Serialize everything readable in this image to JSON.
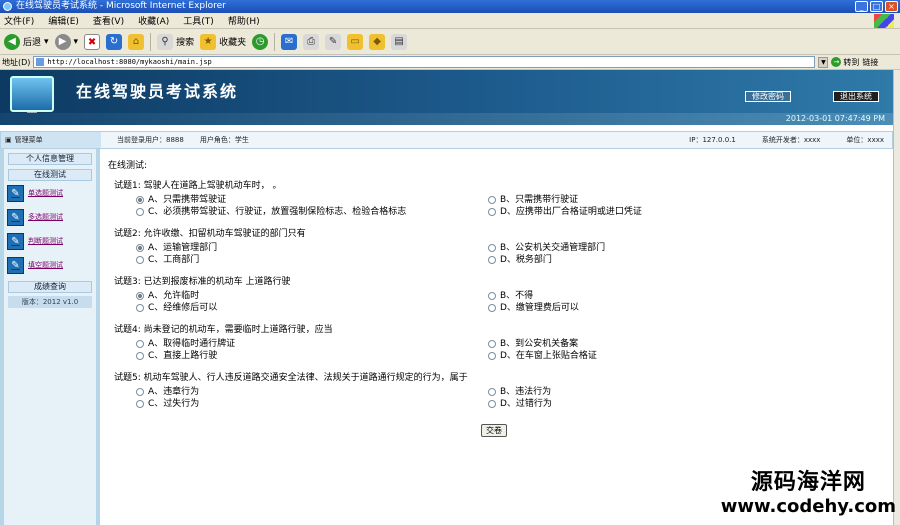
{
  "window": {
    "title": "在线驾驶员考试系统 - Microsoft Internet Explorer"
  },
  "menu": [
    "文件(F)",
    "编辑(E)",
    "查看(V)",
    "收藏(A)",
    "工具(T)",
    "帮助(H)"
  ],
  "toolbar": {
    "back": "后退",
    "search": "搜索",
    "favorites": "收藏夹"
  },
  "address": {
    "label": "地址(D)",
    "url": "http://localhost:8080/mykaoshi/main.jsp",
    "go": "转到",
    "links": "链接"
  },
  "banner": {
    "title": "在线驾驶员考试系统",
    "change_password": "修改密码",
    "logout": "退出系统",
    "datetime": "2012-03-01 07:47:49 PM"
  },
  "infobar": {
    "menu_title": "管理菜单",
    "current_user": "当前登录用户：8888",
    "role": "用户角色：学生",
    "ip": "IP：127.0.0.1",
    "developer": "系统开发者：xxxx",
    "unit": "单位：xxxx"
  },
  "sidebar": {
    "personal": "个人信息管理",
    "online_test": "在线测试",
    "items": [
      "单选题测试",
      "多选题测试",
      "判断题测试",
      "填空题测试"
    ],
    "grades": "成绩查询",
    "version": "版本：2012 v1.0"
  },
  "main": {
    "heading": "在线测试:",
    "submit": "交卷"
  },
  "questions": [
    {
      "title": "试题1: 驾驶人在道路上驾驶机动车时，   。",
      "options": [
        "A、只需携带驾驶证",
        "B、只需携带行驶证",
        "C、必须携带驾驶证、行驶证，放置强制保险标志、检验合格标志",
        "D、应携带出厂合格证明或进口凭证"
      ],
      "selected": 0
    },
    {
      "title": "试题2: 允许收缴、扣留机动车驾驶证的部门只有",
      "options": [
        "A、运输管理部门",
        "B、公安机关交通管理部门",
        "C、工商部门",
        "D、税务部门"
      ],
      "selected": 0
    },
    {
      "title": "试题3: 已达到报废标准的机动车    上道路行驶",
      "options": [
        "A、允许临时",
        "B、不得",
        "C、经维修后可以",
        "D、缴管理费后可以"
      ],
      "selected": 0
    },
    {
      "title": "试题4: 尚未登记的机动车，需要临时上道路行驶，应当",
      "options": [
        "A、取得临时通行牌证",
        "B、到公安机关备案",
        "C、直接上路行驶",
        "D、在车窗上张贴合格证"
      ],
      "selected": -1
    },
    {
      "title": "试题5: 机动车驾驶人、行人违反道路交通安全法律、法规关于道路通行规定的行为，属于",
      "options": [
        "A、违章行为",
        "B、违法行为",
        "C、过失行为",
        "D、过错行为"
      ],
      "selected": -1
    }
  ],
  "watermark": {
    "line1": "源码海洋网",
    "line2": "www.codehy.com"
  }
}
